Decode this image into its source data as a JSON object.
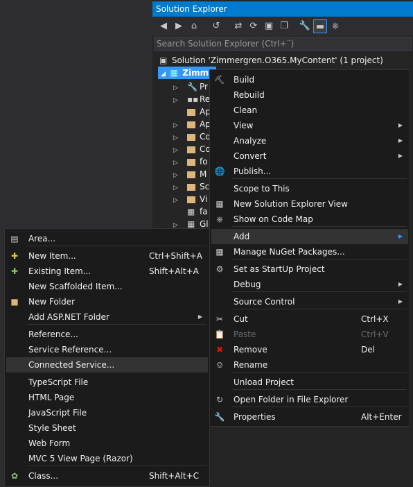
{
  "solution_explorer": {
    "title": "Solution Explorer",
    "search_placeholder": "Search Solution Explorer (Ctrl+¨)",
    "solution_label": "Solution 'Zimmergren.O365.MyContent' (1 project)",
    "project_label": "Zimm",
    "tree_items": [
      "Pr",
      "Re",
      "Ap",
      "Ap",
      "Co",
      "Co",
      "fo",
      "M",
      "Sc",
      "Vi",
      "fa",
      "Gl"
    ]
  },
  "context_menu": {
    "items": [
      {
        "label": "Build",
        "icon": "build-icon"
      },
      {
        "label": "Rebuild"
      },
      {
        "label": "Clean"
      },
      {
        "label": "View",
        "submenu": true
      },
      {
        "label": "Analyze",
        "submenu": true
      },
      {
        "label": "Convert",
        "submenu": true
      },
      {
        "label": "Publish...",
        "icon": "publish-icon"
      },
      {
        "label": "Scope to This"
      },
      {
        "label": "New Solution Explorer View",
        "icon": "new-view-icon"
      },
      {
        "label": "Show on Code Map",
        "icon": "code-map-icon"
      },
      {
        "label": "Add",
        "submenu": true
      },
      {
        "label": "Manage NuGet Packages...",
        "icon": "nuget-icon"
      },
      {
        "label": "Set as StartUp Project",
        "icon": "gear-icon"
      },
      {
        "label": "Debug",
        "submenu": true
      },
      {
        "label": "Source Control",
        "submenu": true
      },
      {
        "label": "Cut",
        "shortcut": "Ctrl+X",
        "icon": "scissors-icon"
      },
      {
        "label": "Paste",
        "shortcut": "Ctrl+V",
        "icon": "paste-icon"
      },
      {
        "label": "Remove",
        "shortcut": "Del",
        "icon": "remove-icon"
      },
      {
        "label": "Rename",
        "icon": "rename-icon"
      },
      {
        "label": "Unload Project"
      },
      {
        "label": "Open Folder in File Explorer",
        "icon": "open-folder-icon"
      },
      {
        "label": "Properties",
        "shortcut": "Alt+Enter",
        "icon": "wrench-icon"
      }
    ]
  },
  "add_submenu": {
    "items": [
      {
        "label": "Area...",
        "icon": "area-icon"
      },
      {
        "label": "New Item...",
        "shortcut": "Ctrl+Shift+A",
        "icon": "new-item-icon"
      },
      {
        "label": "Existing Item...",
        "shortcut": "Shift+Alt+A",
        "icon": "existing-item-icon"
      },
      {
        "label": "New Scaffolded Item..."
      },
      {
        "label": "New Folder",
        "icon": "folder-icon"
      },
      {
        "label": "Add ASP.NET Folder",
        "submenu": true
      },
      {
        "label": "Reference..."
      },
      {
        "label": "Service Reference..."
      },
      {
        "label": "Connected Service..."
      },
      {
        "label": "TypeScript File"
      },
      {
        "label": "HTML Page"
      },
      {
        "label": "JavaScript File"
      },
      {
        "label": "Style Sheet"
      },
      {
        "label": "Web Form"
      },
      {
        "label": "MVC 5 View Page (Razor)"
      },
      {
        "label": "Class...",
        "shortcut": "Shift+Alt+C",
        "icon": "class-icon"
      }
    ]
  }
}
